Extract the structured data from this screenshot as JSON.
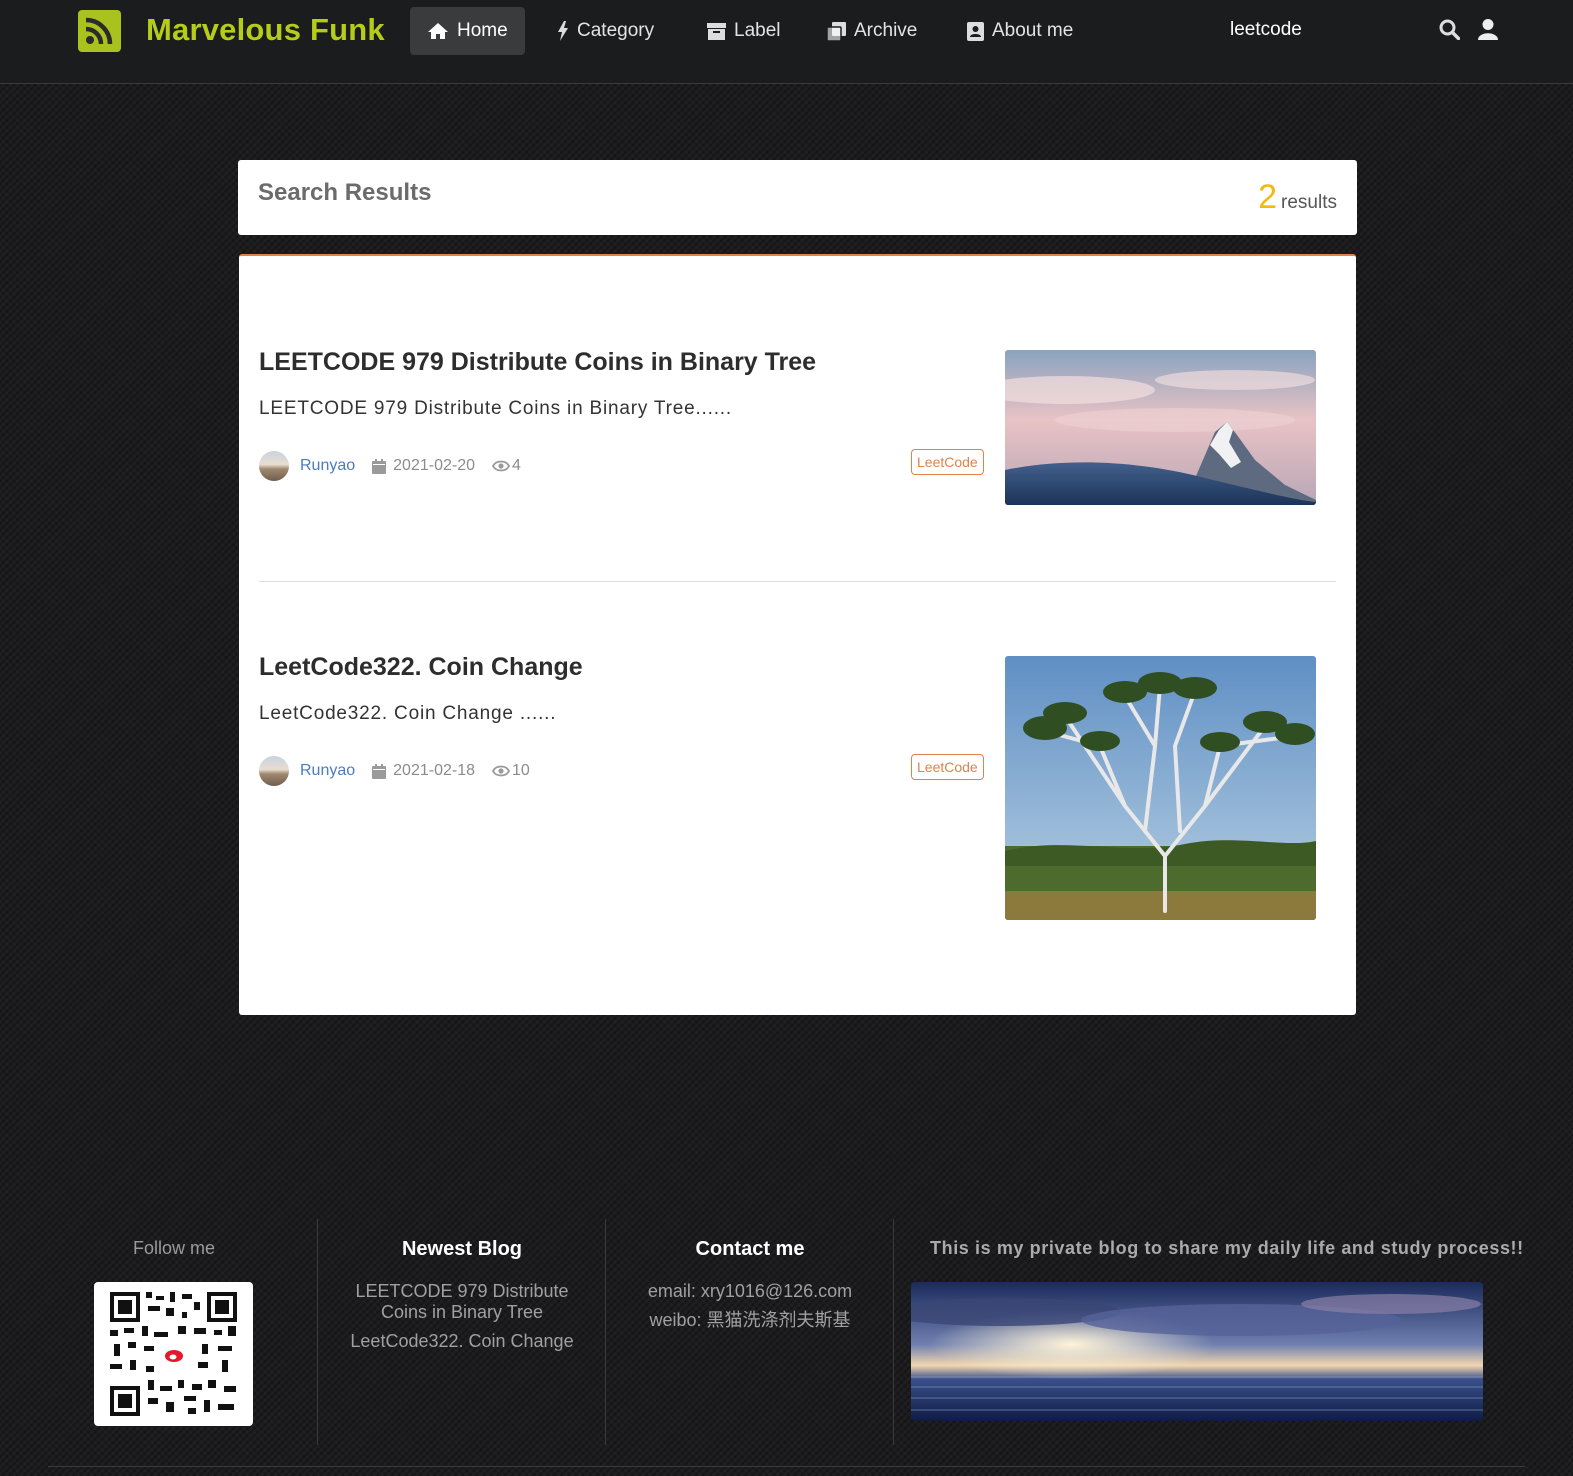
{
  "brand": {
    "name": "Marvelous Funk",
    "accent_color": "#b5cc18",
    "icon": "rss-icon"
  },
  "nav": {
    "items": [
      {
        "label": "Home",
        "icon": "home-icon",
        "active": true
      },
      {
        "label": "Category",
        "icon": "lightning-icon",
        "active": false
      },
      {
        "label": "Label",
        "icon": "archive-box-icon",
        "active": false
      },
      {
        "label": "Archive",
        "icon": "clone-icon",
        "active": false
      },
      {
        "label": "About me",
        "icon": "contact-card-icon",
        "active": false
      }
    ],
    "search_query": "leetcode",
    "right_icons": [
      "search-icon",
      "user-icon"
    ]
  },
  "results": {
    "title": "Search Results",
    "count": "2",
    "count_label": "results",
    "count_color": "#f2b90f"
  },
  "posts": [
    {
      "title": "LEETCODE 979 Distribute Coins in Binary Tree",
      "excerpt": "LEETCODE 979 Distribute Coins in Binary Tree......",
      "author": "Runyao",
      "date": "2021-02-20",
      "views": "4",
      "tag": "LeetCode",
      "image": "mountain-peak-image"
    },
    {
      "title": "LeetCode322. Coin Change",
      "excerpt": "LeetCode322. Coin Change ......",
      "author": "Runyao",
      "date": "2021-02-18",
      "views": "10",
      "tag": "LeetCode",
      "image": "tree-savanna-image"
    }
  ],
  "footer": {
    "follow": {
      "heading": "Follow me",
      "image": "weibo-qr-code"
    },
    "newest": {
      "heading": "Newest Blog",
      "items": [
        "LEETCODE 979 Distribute Coins in Binary Tree",
        "LeetCode322. Coin Change"
      ]
    },
    "contact": {
      "heading": "Contact me",
      "email": "email: xry1016@126.com",
      "weibo": "weibo: 黑猫洗涤剂夫斯基"
    },
    "slogan": "This is my private blog to share my daily life and study process!!",
    "image": "ocean-sunset-image"
  }
}
